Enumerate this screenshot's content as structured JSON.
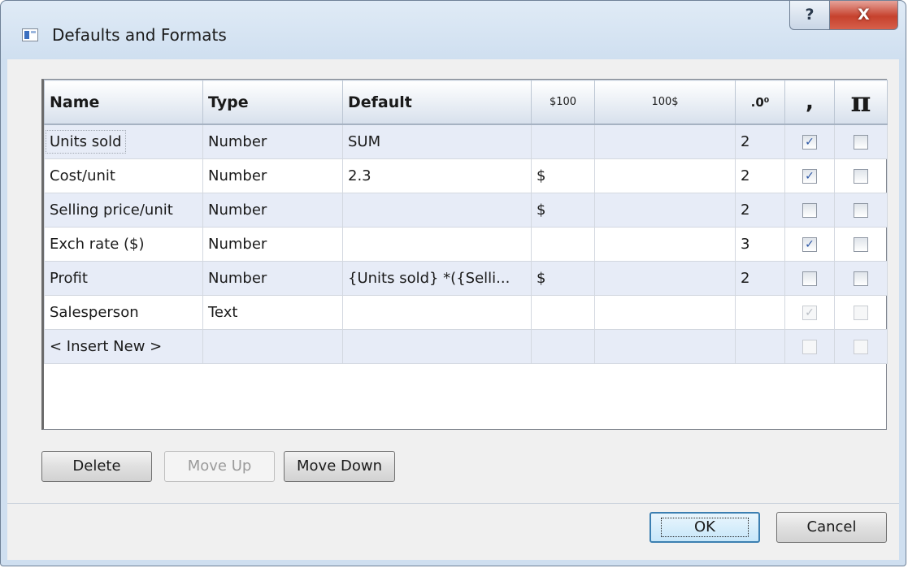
{
  "window": {
    "title": "Defaults and Formats",
    "help_label": "?",
    "close_label": "X"
  },
  "grid": {
    "headers": [
      "Name",
      "Type",
      "Default",
      "$100",
      "100$",
      ".0⁰",
      ",",
      "π"
    ],
    "rows": [
      {
        "name": "Units sold",
        "type": "Number",
        "default": "SUM",
        "prefix": "",
        "suffix": "",
        "decimals": "2",
        "comma": true,
        "pi": false
      },
      {
        "name": "Cost/unit",
        "type": "Number",
        "default": "2.3",
        "prefix": "$",
        "suffix": "",
        "decimals": "2",
        "comma": true,
        "pi": false
      },
      {
        "name": "Selling price/unit",
        "type": "Number",
        "default": "",
        "prefix": "$",
        "suffix": "",
        "decimals": "2",
        "comma": false,
        "pi": false
      },
      {
        "name": "Exch rate ($)",
        "type": "Number",
        "default": "",
        "prefix": "",
        "suffix": "",
        "decimals": "3",
        "comma": true,
        "pi": false
      },
      {
        "name": "Profit",
        "type": "Number",
        "default": "{Units sold} *({Selli...",
        "prefix": "$",
        "suffix": "",
        "decimals": "2",
        "comma": false,
        "pi": false
      },
      {
        "name": "Salesperson",
        "type": "Text",
        "default": "",
        "prefix": "",
        "suffix": "",
        "decimals": "",
        "comma": true,
        "pi": false
      },
      {
        "name": "< Insert New >",
        "type": "",
        "default": "",
        "prefix": "",
        "suffix": "",
        "decimals": "",
        "comma": false,
        "pi": false
      }
    ]
  },
  "buttons": {
    "delete": "Delete",
    "move_up": "Move Up",
    "move_down": "Move Down",
    "ok": "OK",
    "cancel": "Cancel"
  }
}
